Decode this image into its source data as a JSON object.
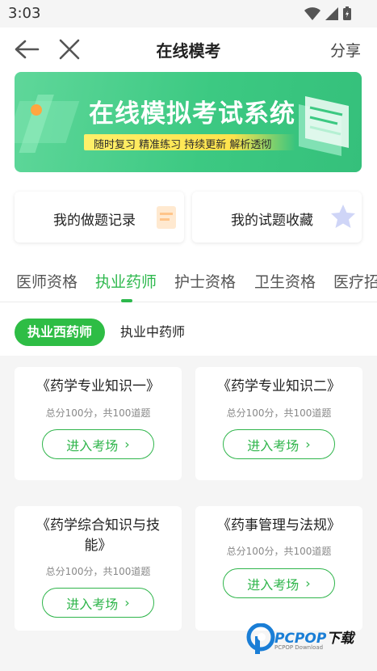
{
  "status_bar": {
    "time": "3:03"
  },
  "navbar": {
    "title": "在线模考",
    "share_label": "分享"
  },
  "banner": {
    "title": "在线模拟考试系统",
    "subtitle": "随时复习 精准练习 持续更新 解析透彻",
    "colors": {
      "from": "#5fd79a",
      "to": "#35c07b",
      "strip": "#ffe34c"
    }
  },
  "quick_links": [
    {
      "label": "我的做题记录",
      "icon": "notebook-icon"
    },
    {
      "label": "我的试题收藏",
      "icon": "star-icon"
    }
  ],
  "category_tabs": [
    {
      "label": "医师资格",
      "active": false
    },
    {
      "label": "执业药师",
      "active": true
    },
    {
      "label": "护士资格",
      "active": false
    },
    {
      "label": "卫生资格",
      "active": false
    },
    {
      "label": "医疗招",
      "active": false
    }
  ],
  "sub_tabs": [
    {
      "label": "执业西药师",
      "active": true
    },
    {
      "label": "执业中药师",
      "active": false
    }
  ],
  "exam_papers": [
    {
      "title": "《药学专业知识一》",
      "meta": "总分100分，共100道题",
      "button": "进入考场"
    },
    {
      "title": "《药学专业知识二》",
      "meta": "总分100分，共100道题",
      "button": "进入考场"
    },
    {
      "title": "《药学综合知识与技能》",
      "meta": "总分100分，共100道题",
      "button": "进入考场"
    },
    {
      "title": "《药事管理与法规》",
      "meta": "总分100分，共100道题",
      "button": "进入考场"
    }
  ],
  "watermark": {
    "brand": "PCPOP",
    "brand_cn": "下载",
    "sub": "PCPOP Download"
  },
  "colors": {
    "accent": "#2db84d",
    "background": "#f5f5f5"
  }
}
